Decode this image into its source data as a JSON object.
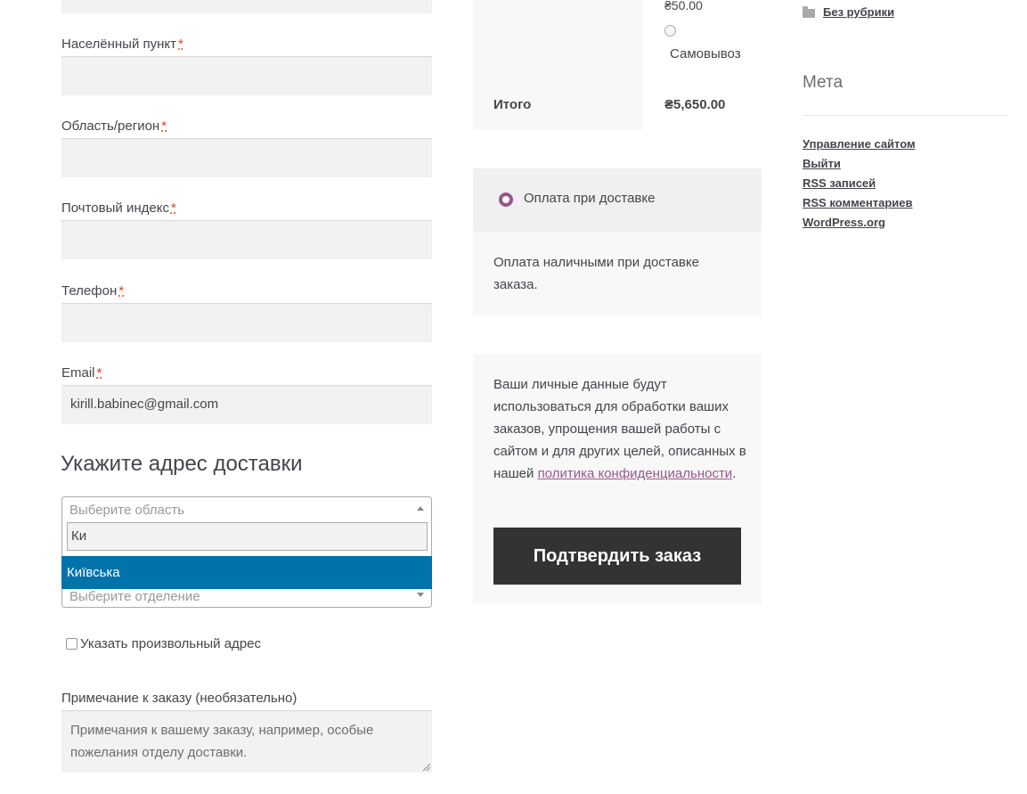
{
  "billing": {
    "city_label": "Населённый пункт",
    "region_label": "Область/регион",
    "postcode_label": "Почтовый индекс",
    "phone_label": "Телефон",
    "email_label": "Email",
    "required_mark": "*",
    "email_value": "kirill.babinec@gmail.com"
  },
  "shipping": {
    "section_title": "Укажите адрес доставки",
    "region_placeholder": "Выберите область",
    "search_value": "Ки",
    "highlighted_option": "Київська",
    "branch_placeholder": "Выберите отделение",
    "custom_address_label": "Указать произвольный адрес"
  },
  "notes": {
    "label": "Примечание к заказу (необязательно)",
    "placeholder": "Примечания к вашему заказу, например, особые пожелания отделу доставки."
  },
  "order_review": {
    "shipping_price": "₴50.00",
    "pickup_label": "Самовывоз",
    "total_label": "Итого",
    "total_value": "₴5,650.00"
  },
  "payment": {
    "method_title": "Оплата при доставке",
    "method_description": "Оплата наличными при доставке заказа."
  },
  "privacy": {
    "text_before": "Ваши личные данные будут использоваться для обработки ваших заказов, упрощения вашей работы с сайтом и для других целей, описанных в нашей ",
    "link_text": "политика конфиденциальности",
    "text_after": "."
  },
  "place_order": {
    "label": "Подтвердить заказ"
  },
  "sidebar": {
    "category_link": "Без рубрики",
    "meta_title": "Мета",
    "meta_links": [
      "Управление сайтом",
      "Выйти",
      "RSS записей",
      "RSS комментариев",
      "WordPress.org"
    ]
  },
  "colors": {
    "accent": "#96588a",
    "highlight": "#0073aa",
    "button_bg": "#333333"
  }
}
